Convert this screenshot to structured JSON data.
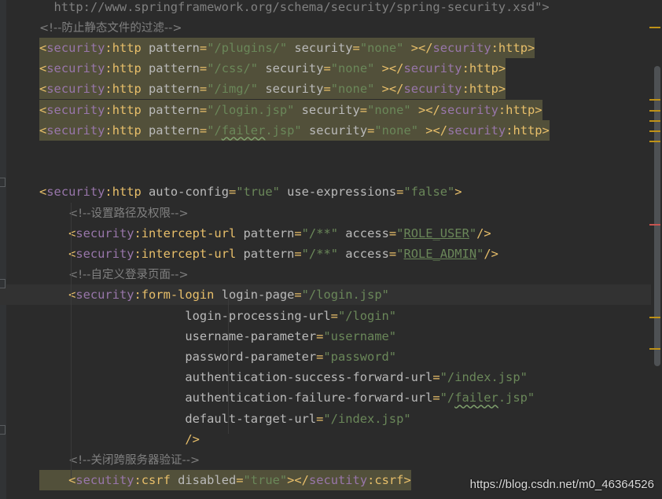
{
  "editor": {
    "lines": [
      {
        "tokens": [
          [
            "cmt-code",
            "  http://www.springframework.org/schema/security/spring-security.xsd\">"
          ]
        ]
      },
      {
        "tokens": [
          [
            "cmt",
            "<!--防止静态文件的过滤-->"
          ]
        ]
      },
      {
        "tokens": [
          [
            "bracket",
            "<"
          ],
          [
            "ns",
            "security"
          ],
          [
            "tag",
            ":http"
          ],
          [
            "attr",
            " pattern"
          ],
          [
            "bracket",
            "="
          ],
          [
            "val",
            "\"/plugins/\""
          ],
          [
            "attr",
            " security"
          ],
          [
            "bracket",
            "="
          ],
          [
            "val",
            "\"none\""
          ],
          [
            "bracket",
            " ></"
          ],
          [
            "ns",
            "security"
          ],
          [
            "tag",
            ":http"
          ],
          [
            "bracket",
            ">"
          ]
        ]
      },
      {
        "tokens": [
          [
            "bracket",
            "<"
          ],
          [
            "ns",
            "security"
          ],
          [
            "tag",
            ":http"
          ],
          [
            "attr",
            " pattern"
          ],
          [
            "bracket",
            "="
          ],
          [
            "val",
            "\"/css/\""
          ],
          [
            "attr",
            " security"
          ],
          [
            "bracket",
            "="
          ],
          [
            "val",
            "\"none\""
          ],
          [
            "bracket",
            " ></"
          ],
          [
            "ns",
            "security"
          ],
          [
            "tag",
            ":http"
          ],
          [
            "bracket",
            ">"
          ]
        ]
      },
      {
        "tokens": [
          [
            "bracket",
            "<"
          ],
          [
            "ns",
            "security"
          ],
          [
            "tag",
            ":http"
          ],
          [
            "attr",
            " pattern"
          ],
          [
            "bracket",
            "="
          ],
          [
            "val",
            "\"/img/\""
          ],
          [
            "attr",
            " security"
          ],
          [
            "bracket",
            "="
          ],
          [
            "val",
            "\"none\""
          ],
          [
            "bracket",
            " ></"
          ],
          [
            "ns",
            "security"
          ],
          [
            "tag",
            ":http"
          ],
          [
            "bracket",
            ">"
          ]
        ]
      },
      {
        "tokens": [
          [
            "bracket",
            "<"
          ],
          [
            "ns",
            "security"
          ],
          [
            "tag",
            ":http"
          ],
          [
            "attr",
            " pattern"
          ],
          [
            "bracket",
            "="
          ],
          [
            "val",
            "\"/login.jsp\""
          ],
          [
            "attr",
            " security"
          ],
          [
            "bracket",
            "="
          ],
          [
            "val",
            "\"none\""
          ],
          [
            "bracket",
            " ></"
          ],
          [
            "ns",
            "security"
          ],
          [
            "tag",
            ":http"
          ],
          [
            "bracket",
            ">"
          ]
        ]
      },
      {
        "tokens": [
          [
            "bracket",
            "<"
          ],
          [
            "ns",
            "security"
          ],
          [
            "tag",
            ":http"
          ],
          [
            "attr",
            " pattern"
          ],
          [
            "bracket",
            "="
          ],
          [
            "val",
            "\"/"
          ],
          [
            "val-typo",
            "failer"
          ],
          [
            "val",
            ".jsp\""
          ],
          [
            "attr",
            " security"
          ],
          [
            "bracket",
            "="
          ],
          [
            "val",
            "\"none\""
          ],
          [
            "bracket",
            " ></"
          ],
          [
            "ns",
            "security"
          ],
          [
            "tag",
            ":http"
          ],
          [
            "bracket",
            ">"
          ]
        ]
      },
      {
        "tokens": []
      },
      {
        "tokens": []
      },
      {
        "tokens": [
          [
            "bracket",
            "<"
          ],
          [
            "ns",
            "security"
          ],
          [
            "tag",
            ":http"
          ],
          [
            "attr",
            " auto-config"
          ],
          [
            "bracket",
            "="
          ],
          [
            "val",
            "\"true\""
          ],
          [
            "attr",
            " use-expressions"
          ],
          [
            "bracket",
            "="
          ],
          [
            "val",
            "\"false\""
          ],
          [
            "bracket",
            ">"
          ]
        ]
      },
      {
        "tokens": [
          [
            "indent",
            "    "
          ],
          [
            "cmt",
            "<!--设置路径及权限-->"
          ]
        ]
      },
      {
        "tokens": [
          [
            "indent",
            "    "
          ],
          [
            "bracket",
            "<"
          ],
          [
            "ns",
            "security"
          ],
          [
            "tag",
            ":intercept-url"
          ],
          [
            "attr",
            " pattern"
          ],
          [
            "bracket",
            "="
          ],
          [
            "val",
            "\"/**\""
          ],
          [
            "attr",
            " access"
          ],
          [
            "bracket",
            "="
          ],
          [
            "val",
            "\""
          ],
          [
            "val-under",
            "ROLE_USER"
          ],
          [
            "val",
            "\""
          ],
          [
            "bracket",
            "/>"
          ]
        ]
      },
      {
        "tokens": [
          [
            "indent",
            "    "
          ],
          [
            "bracket",
            "<"
          ],
          [
            "ns",
            "security"
          ],
          [
            "tag",
            ":intercept-url"
          ],
          [
            "attr",
            " pattern"
          ],
          [
            "bracket",
            "="
          ],
          [
            "val",
            "\"/**\""
          ],
          [
            "attr",
            " access"
          ],
          [
            "bracket",
            "="
          ],
          [
            "val",
            "\""
          ],
          [
            "val-under",
            "ROLE_ADMIN"
          ],
          [
            "val",
            "\""
          ],
          [
            "bracket",
            "/>"
          ]
        ]
      },
      {
        "tokens": [
          [
            "indent",
            "    "
          ],
          [
            "cmt",
            "<!--自定义登录页面-->"
          ]
        ]
      },
      {
        "tokens": [
          [
            "indent",
            "    "
          ],
          [
            "bracket",
            "<"
          ],
          [
            "ns",
            "security"
          ],
          [
            "tag",
            ":form-login"
          ],
          [
            "attr",
            " login-page"
          ],
          [
            "bracket",
            "="
          ],
          [
            "val",
            "\"/login.jsp\""
          ]
        ]
      },
      {
        "tokens": [
          [
            "indent",
            "                    "
          ],
          [
            "attr",
            "login-processing-url"
          ],
          [
            "bracket",
            "="
          ],
          [
            "val",
            "\"/login\""
          ]
        ]
      },
      {
        "tokens": [
          [
            "indent",
            "                    "
          ],
          [
            "attr",
            "username-parameter"
          ],
          [
            "bracket",
            "="
          ],
          [
            "val",
            "\"username\""
          ]
        ]
      },
      {
        "tokens": [
          [
            "indent",
            "                    "
          ],
          [
            "attr",
            "password-parameter"
          ],
          [
            "bracket",
            "="
          ],
          [
            "val",
            "\"password\""
          ]
        ]
      },
      {
        "tokens": [
          [
            "indent",
            "                    "
          ],
          [
            "attr",
            "authentication-success-forward-url"
          ],
          [
            "bracket",
            "="
          ],
          [
            "val",
            "\"/index.jsp\""
          ]
        ]
      },
      {
        "tokens": [
          [
            "indent",
            "                    "
          ],
          [
            "attr",
            "authentication-failure-forward-url"
          ],
          [
            "bracket",
            "="
          ],
          [
            "val",
            "\"/"
          ],
          [
            "val-typo",
            "failer"
          ],
          [
            "val",
            ".jsp\""
          ]
        ]
      },
      {
        "tokens": [
          [
            "indent",
            "                    "
          ],
          [
            "attr",
            "default-target-url"
          ],
          [
            "bracket",
            "="
          ],
          [
            "val",
            "\"/index.jsp\""
          ]
        ]
      },
      {
        "tokens": [
          [
            "indent",
            "                    "
          ],
          [
            "bracket",
            "/>"
          ]
        ]
      },
      {
        "tokens": [
          [
            "indent",
            "    "
          ],
          [
            "cmt",
            "<!--关闭跨服务器验证-->"
          ]
        ]
      },
      {
        "tokens": [
          [
            "indent",
            "    "
          ],
          [
            "bracket",
            "<"
          ],
          [
            "ns",
            "secutity"
          ],
          [
            "tag",
            ":csrf"
          ],
          [
            "attr",
            " disabled"
          ],
          [
            "bracket",
            "="
          ],
          [
            "val",
            "\"true\""
          ],
          [
            "bracket",
            "></"
          ],
          [
            "ns",
            "secutity"
          ],
          [
            "tag",
            ":csrf"
          ],
          [
            "bracket",
            ">"
          ]
        ]
      }
    ]
  },
  "colors": {
    "background": "#2b2b2b",
    "highlight": "#52503a",
    "marker_warning": "#be9117",
    "marker_error": "#c75450"
  },
  "watermark": "https://blog.csdn.net/m0_46364526"
}
